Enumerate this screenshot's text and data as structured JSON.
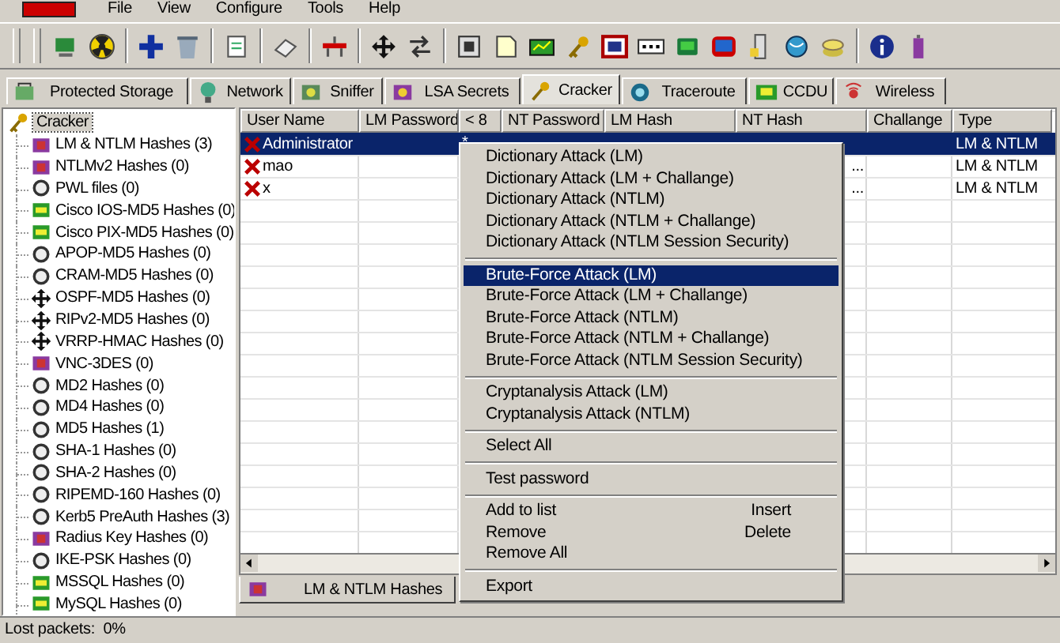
{
  "menu_bar": [
    "File",
    "View",
    "Configure",
    "Tools",
    "Help"
  ],
  "tabs": [
    {
      "label": "Protected Storage",
      "selected": false
    },
    {
      "label": "Network",
      "selected": false
    },
    {
      "label": "Sniffer",
      "selected": false
    },
    {
      "label": "LSA Secrets",
      "selected": false
    },
    {
      "label": "Cracker",
      "selected": true
    },
    {
      "label": "Traceroute",
      "selected": false
    },
    {
      "label": "CCDU",
      "selected": false
    },
    {
      "label": "Wireless",
      "selected": false
    }
  ],
  "tree": {
    "label": "Cracker",
    "selected": true,
    "children": [
      {
        "label": "LM & NTLM Hashes (3)"
      },
      {
        "label": "NTLMv2 Hashes (0)"
      },
      {
        "label": "PWL files (0)"
      },
      {
        "label": "Cisco IOS-MD5 Hashes (0)"
      },
      {
        "label": "Cisco PIX-MD5 Hashes (0)"
      },
      {
        "label": "APOP-MD5 Hashes (0)"
      },
      {
        "label": "CRAM-MD5 Hashes (0)"
      },
      {
        "label": "OSPF-MD5 Hashes (0)"
      },
      {
        "label": "RIPv2-MD5 Hashes (0)"
      },
      {
        "label": "VRRP-HMAC Hashes (0)"
      },
      {
        "label": "VNC-3DES (0)"
      },
      {
        "label": "MD2 Hashes (0)"
      },
      {
        "label": "MD4 Hashes (0)"
      },
      {
        "label": "MD5 Hashes (1)"
      },
      {
        "label": "SHA-1 Hashes (0)"
      },
      {
        "label": "SHA-2 Hashes (0)"
      },
      {
        "label": "RIPEMD-160 Hashes (0)"
      },
      {
        "label": "Kerb5 PreAuth Hashes (3)"
      },
      {
        "label": "Radius Key Hashes (0)"
      },
      {
        "label": "IKE-PSK Hashes (0)"
      },
      {
        "label": "MSSQL Hashes (0)"
      },
      {
        "label": "MySQL Hashes (0)"
      }
    ]
  },
  "table": {
    "columns": [
      "User Name",
      "LM Password",
      "< 8",
      "NT Password",
      "LM Hash",
      "NT Hash",
      "Challange",
      "Type"
    ],
    "rows": [
      {
        "selected": true,
        "cells": [
          "Administrator",
          "",
          "*",
          "",
          "",
          "",
          "",
          "LM & NTLM"
        ]
      },
      {
        "selected": false,
        "cells": [
          "mao",
          "",
          "",
          "",
          "",
          "...",
          "",
          "LM & NTLM"
        ]
      },
      {
        "selected": false,
        "cells": [
          "x",
          "",
          "",
          "",
          "",
          "...",
          "",
          "LM & NTLM"
        ]
      }
    ]
  },
  "bottom_tab": "LM & NTLM Hashes",
  "context_menu": {
    "groups": [
      [
        {
          "label": "Dictionary Attack (LM)",
          "selected": false
        },
        {
          "label": "Dictionary Attack (LM + Challange)",
          "selected": false
        },
        {
          "label": "Dictionary Attack (NTLM)",
          "selected": false
        },
        {
          "label": "Dictionary Attack (NTLM + Challange)",
          "selected": false
        },
        {
          "label": "Dictionary Attack (NTLM Session Security)",
          "selected": false
        }
      ],
      [
        {
          "label": "Brute-Force Attack (LM)",
          "selected": true
        },
        {
          "label": "Brute-Force Attack (LM + Challange)",
          "selected": false
        },
        {
          "label": "Brute-Force Attack (NTLM)",
          "selected": false
        },
        {
          "label": "Brute-Force Attack (NTLM + Challange)",
          "selected": false
        },
        {
          "label": "Brute-Force Attack (NTLM Session Security)",
          "selected": false
        }
      ],
      [
        {
          "label": "Cryptanalysis Attack (LM)",
          "selected": false
        },
        {
          "label": "Cryptanalysis Attack (NTLM)",
          "selected": false
        }
      ],
      [
        {
          "label": "Select All",
          "selected": false
        }
      ],
      [
        {
          "label": "Test password",
          "selected": false
        }
      ],
      [
        {
          "label": "Add to list",
          "shortcut": "Insert",
          "selected": false
        },
        {
          "label": "Remove",
          "shortcut": "Delete",
          "selected": false
        },
        {
          "label": "Remove All",
          "selected": false
        }
      ],
      [
        {
          "label": "Export",
          "selected": false
        }
      ]
    ]
  },
  "status_bar": "Lost packets:  0%"
}
